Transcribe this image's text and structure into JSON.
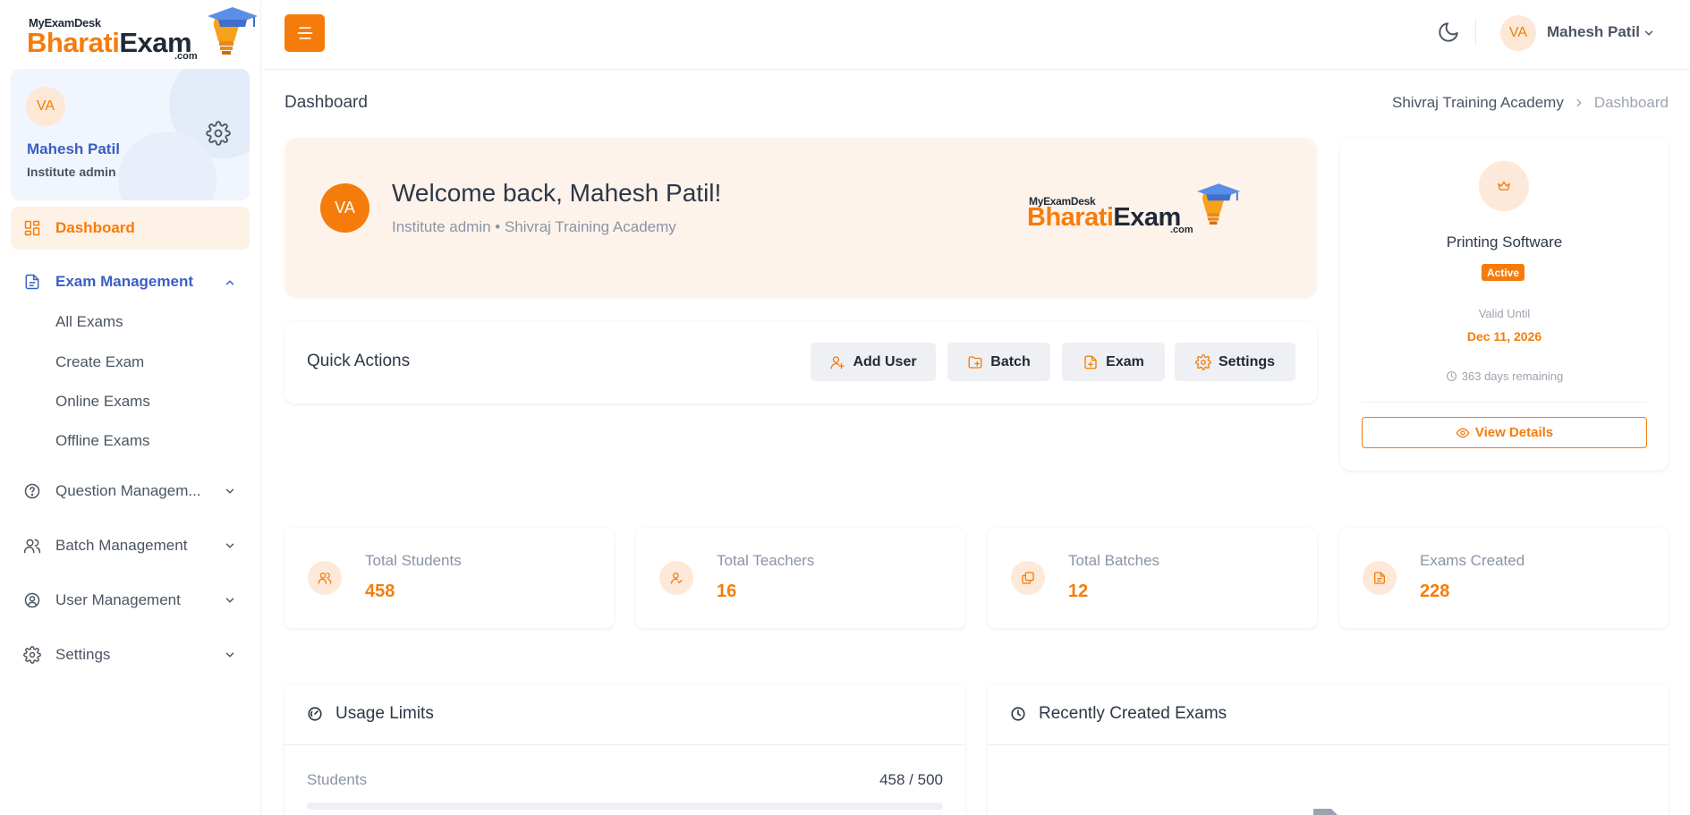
{
  "brand": {
    "small": "MyExamDesk",
    "name_part1": "Bharati",
    "name_part2": "Exam",
    "suffix": ".com"
  },
  "sidebar": {
    "profile": {
      "initials": "VA",
      "name": "Mahesh Patil",
      "role": "Institute admin"
    },
    "items": [
      {
        "label": "Dashboard",
        "icon": "dashboard-icon",
        "state": "active"
      },
      {
        "label": "Exam Management",
        "icon": "document-icon",
        "state": "open",
        "children": [
          "All Exams",
          "Create Exam",
          "Online Exams",
          "Offline Exams"
        ]
      },
      {
        "label": "Question Managem...",
        "icon": "question-icon",
        "state": "collapsed"
      },
      {
        "label": "Batch Management",
        "icon": "users-icon",
        "state": "collapsed"
      },
      {
        "label": "User Management",
        "icon": "user-circle-icon",
        "state": "collapsed"
      },
      {
        "label": "Settings",
        "icon": "gear-icon",
        "state": "collapsed"
      }
    ]
  },
  "topbar": {
    "initials": "VA",
    "user_name": "Mahesh Patil"
  },
  "page": {
    "title": "Dashboard",
    "breadcrumb": [
      "Shivraj Training Academy",
      "Dashboard"
    ]
  },
  "welcome": {
    "initials": "VA",
    "title": "Welcome back, Mahesh Patil!",
    "subtitle": "Institute admin • Shivraj Training Academy"
  },
  "quick_actions": {
    "title": "Quick Actions",
    "buttons": [
      {
        "label": "Add User",
        "icon": "add-user-icon"
      },
      {
        "label": "Batch",
        "icon": "folder-plus-icon"
      },
      {
        "label": "Exam",
        "icon": "file-plus-icon"
      },
      {
        "label": "Settings",
        "icon": "gear-icon"
      }
    ]
  },
  "subscription": {
    "name": "Printing Software",
    "status": "Active",
    "valid_label": "Valid Until",
    "valid_date": "Dec 11, 2026",
    "remaining": "363 days remaining",
    "button": "View Details"
  },
  "stats": [
    {
      "label": "Total Students",
      "value": "458",
      "icon": "users-icon"
    },
    {
      "label": "Total Teachers",
      "value": "16",
      "icon": "teacher-icon"
    },
    {
      "label": "Total Batches",
      "value": "12",
      "icon": "layers-icon"
    },
    {
      "label": "Exams Created",
      "value": "228",
      "icon": "document-icon"
    }
  ],
  "usage": {
    "title": "Usage Limits",
    "rows": [
      {
        "label": "Students",
        "value": "458 / 500",
        "used": 458,
        "limit": 500
      }
    ]
  },
  "recent_exams": {
    "title": "Recently Created Exams"
  },
  "colors": {
    "accent": "#f57c0a",
    "accent_soft": "#fde9d9",
    "link_blue": "#3b5fc4"
  }
}
